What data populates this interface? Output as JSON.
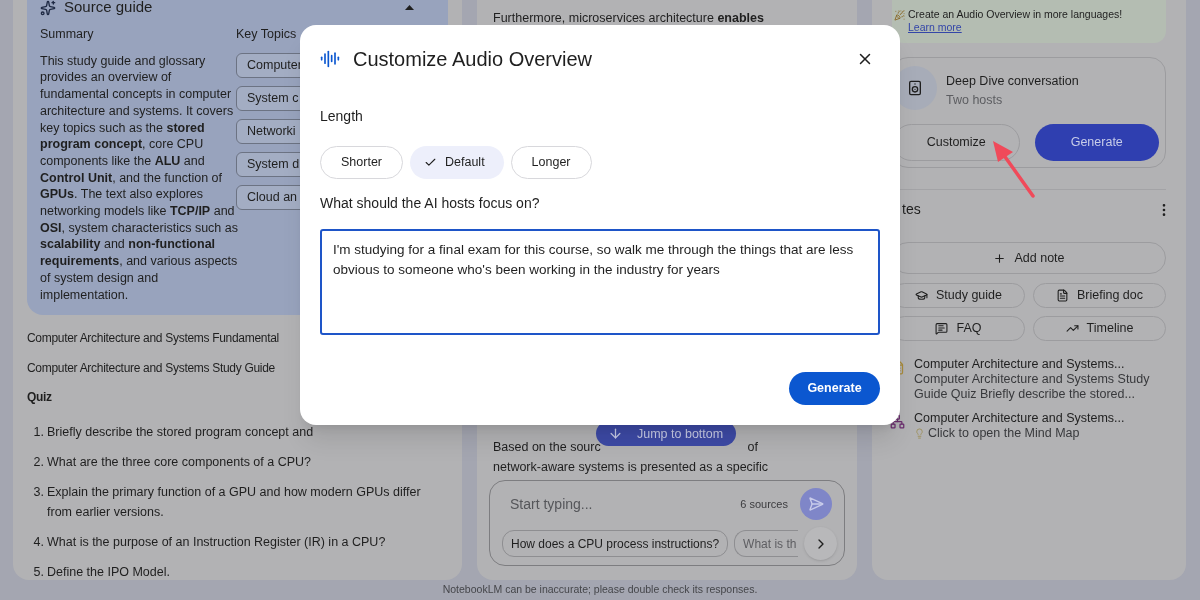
{
  "source_guide": {
    "title": "Source guide",
    "summary_heading": "Summary",
    "summary": "This study guide and glossary provides an overview of fundamental concepts in computer architecture and systems. It covers key topics such as the **stored program concept**, core CPU components like the **ALU** and **Control Unit**, and the function of **GPUs**. The text also explores networking models like **TCP/IP** and **OSI**, system characteristics such as **scalability** and **non-functional requirements**, and various aspects of system design and implementation.",
    "key_topics_heading": "Key Topics",
    "key_topics": [
      "Computer",
      "System c",
      "Networki",
      "System d",
      "Cloud an"
    ]
  },
  "source_content": {
    "lines": [
      {
        "text": "Computer Architecture and Systems Fundamental",
        "bold": false
      },
      {
        "text": "Computer Architecture and Systems Study Guide",
        "bold": false
      },
      {
        "text": "Quiz",
        "bold": true
      }
    ],
    "quiz": [
      {
        "number": "1.",
        "text": "Briefly describe the stored program concept and"
      },
      {
        "number": "2.",
        "text": "What are the three core components of a CPU?"
      },
      {
        "number": "3.",
        "text": "Explain the primary function of a GPU and how modern GPUs differ from earlier versions."
      },
      {
        "number": "4.",
        "text": "What is the purpose of an Instruction Register (IR) in a CPU?"
      },
      {
        "number": "5.",
        "text": "Define the IPO Model."
      }
    ]
  },
  "chat": {
    "top_text": "Furthermore, microservices architecture **enables**",
    "bottom_text_start": "Based on the sourc",
    "bottom_text_end": "of",
    "bottom_text_line_2": "network-aware systems is presented as a specific",
    "jump_button": "Jump to bottom",
    "input": {
      "placeholder": "Start typing..."
    },
    "source_count": "6 sources",
    "suggestions": [
      {
        "text": "How does a CPU process instructions?",
        "faded": false
      },
      {
        "text": "What is th",
        "faded": true
      }
    ]
  },
  "studio": {
    "banner": {
      "text": "Create an Audio Overview in more languages!",
      "link": "Learn more"
    },
    "audio": {
      "title": "Deep Dive conversation",
      "subtitle": "Two hosts",
      "buttons": [
        {
          "label": "Customize",
          "kind": "outline"
        },
        {
          "label": "Generate",
          "kind": "filled"
        }
      ]
    },
    "notes_heading": "tes",
    "add_note": "Add note",
    "note_actions": [
      {
        "label": "Study guide",
        "kind": "study"
      },
      {
        "label": "Briefing doc",
        "kind": "briefing"
      },
      {
        "label": "FAQ",
        "kind": "faq"
      },
      {
        "label": "Timeline",
        "kind": "timeline"
      }
    ],
    "notes": [
      {
        "title": "Computer Architecture and Systems...",
        "snippet": "Computer Architecture and Systems Study Guide Quiz Briefly describe the stored...",
        "kind": "document"
      },
      {
        "title": "Computer Architecture and Systems...",
        "snippet": "Click to open the Mind Map",
        "kind": "mindmap"
      }
    ]
  },
  "dialog": {
    "title": "Customize Audio Overview",
    "length_label": "Length",
    "length_options": [
      {
        "label": "Shorter",
        "selected": false
      },
      {
        "label": "Default",
        "selected": true
      },
      {
        "label": "Longer",
        "selected": false
      }
    ],
    "focus_label": "What should the AI hosts focus on?",
    "focus_value": "I'm studying for a final exam for this course, so walk me through the things that are less obvious to someone who's been working in the industry for years",
    "submit": "Generate"
  },
  "footer": "NotebookLM can be inaccurate; please double check its responses."
}
